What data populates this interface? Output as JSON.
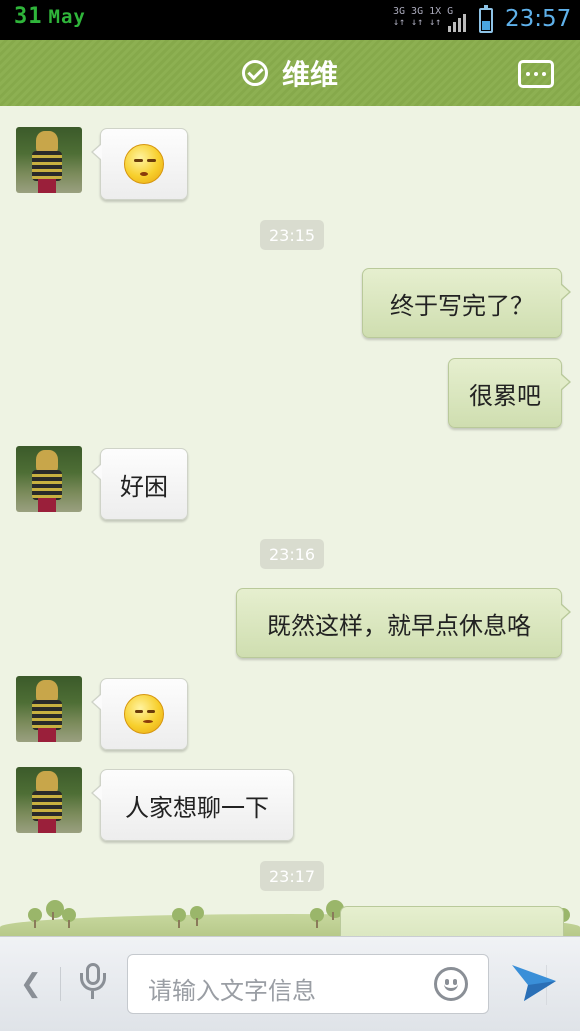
{
  "status_bar": {
    "date_day": "31",
    "date_month": "May",
    "network_top": "3G 3G 1X G",
    "network_bottom": "↓↑ ↓↑ ↓↑",
    "time": "23:57"
  },
  "header": {
    "title": "维维",
    "title_icon": "check-circle-icon",
    "menu_icon": "more-dots-icon"
  },
  "messages": [
    {
      "type": "incoming",
      "kind": "emoji",
      "emoji": "sleepy-face-emoji"
    },
    {
      "type": "timestamp",
      "text": "23:15"
    },
    {
      "type": "outgoing",
      "kind": "text",
      "text": "终于写完了？"
    },
    {
      "type": "outgoing",
      "kind": "text",
      "text": "很累吧"
    },
    {
      "type": "incoming",
      "kind": "text",
      "text": "好困"
    },
    {
      "type": "timestamp",
      "text": "23:16"
    },
    {
      "type": "outgoing",
      "kind": "text",
      "text": "既然这样，就早点休息咯"
    },
    {
      "type": "incoming",
      "kind": "emoji",
      "emoji": "shy-face-emoji"
    },
    {
      "type": "incoming",
      "kind": "text",
      "text": "人家想聊一下"
    },
    {
      "type": "timestamp",
      "text": "23:17"
    }
  ],
  "input_bar": {
    "placeholder": "请输入文字信息",
    "back_icon": "chevron-left-icon",
    "mic_icon": "microphone-icon",
    "emoji_icon": "smiley-icon",
    "send_icon": "send-icon"
  },
  "colors": {
    "header_green": "#8db052",
    "outgoing_bubble": "#d8e5bd",
    "incoming_bubble": "#f5f5f5",
    "status_time": "#5fb1ea",
    "status_date": "#2fb53a"
  }
}
